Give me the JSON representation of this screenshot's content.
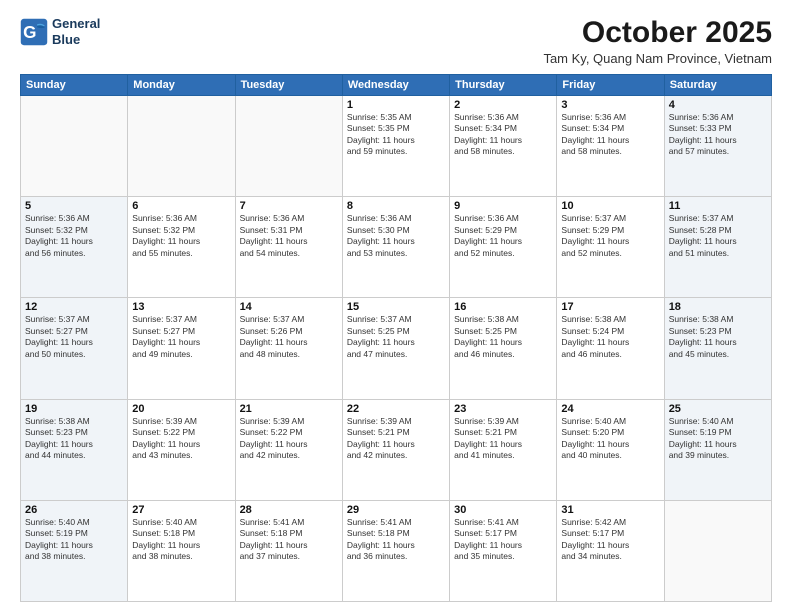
{
  "logo": {
    "line1": "General",
    "line2": "Blue"
  },
  "header": {
    "month": "October 2025",
    "location": "Tam Ky, Quang Nam Province, Vietnam"
  },
  "weekdays": [
    "Sunday",
    "Monday",
    "Tuesday",
    "Wednesday",
    "Thursday",
    "Friday",
    "Saturday"
  ],
  "weeks": [
    [
      {
        "day": "",
        "info": ""
      },
      {
        "day": "",
        "info": ""
      },
      {
        "day": "",
        "info": ""
      },
      {
        "day": "1",
        "info": "Sunrise: 5:35 AM\nSunset: 5:35 PM\nDaylight: 11 hours\nand 59 minutes."
      },
      {
        "day": "2",
        "info": "Sunrise: 5:36 AM\nSunset: 5:34 PM\nDaylight: 11 hours\nand 58 minutes."
      },
      {
        "day": "3",
        "info": "Sunrise: 5:36 AM\nSunset: 5:34 PM\nDaylight: 11 hours\nand 58 minutes."
      },
      {
        "day": "4",
        "info": "Sunrise: 5:36 AM\nSunset: 5:33 PM\nDaylight: 11 hours\nand 57 minutes."
      }
    ],
    [
      {
        "day": "5",
        "info": "Sunrise: 5:36 AM\nSunset: 5:32 PM\nDaylight: 11 hours\nand 56 minutes."
      },
      {
        "day": "6",
        "info": "Sunrise: 5:36 AM\nSunset: 5:32 PM\nDaylight: 11 hours\nand 55 minutes."
      },
      {
        "day": "7",
        "info": "Sunrise: 5:36 AM\nSunset: 5:31 PM\nDaylight: 11 hours\nand 54 minutes."
      },
      {
        "day": "8",
        "info": "Sunrise: 5:36 AM\nSunset: 5:30 PM\nDaylight: 11 hours\nand 53 minutes."
      },
      {
        "day": "9",
        "info": "Sunrise: 5:36 AM\nSunset: 5:29 PM\nDaylight: 11 hours\nand 52 minutes."
      },
      {
        "day": "10",
        "info": "Sunrise: 5:37 AM\nSunset: 5:29 PM\nDaylight: 11 hours\nand 52 minutes."
      },
      {
        "day": "11",
        "info": "Sunrise: 5:37 AM\nSunset: 5:28 PM\nDaylight: 11 hours\nand 51 minutes."
      }
    ],
    [
      {
        "day": "12",
        "info": "Sunrise: 5:37 AM\nSunset: 5:27 PM\nDaylight: 11 hours\nand 50 minutes."
      },
      {
        "day": "13",
        "info": "Sunrise: 5:37 AM\nSunset: 5:27 PM\nDaylight: 11 hours\nand 49 minutes."
      },
      {
        "day": "14",
        "info": "Sunrise: 5:37 AM\nSunset: 5:26 PM\nDaylight: 11 hours\nand 48 minutes."
      },
      {
        "day": "15",
        "info": "Sunrise: 5:37 AM\nSunset: 5:25 PM\nDaylight: 11 hours\nand 47 minutes."
      },
      {
        "day": "16",
        "info": "Sunrise: 5:38 AM\nSunset: 5:25 PM\nDaylight: 11 hours\nand 46 minutes."
      },
      {
        "day": "17",
        "info": "Sunrise: 5:38 AM\nSunset: 5:24 PM\nDaylight: 11 hours\nand 46 minutes."
      },
      {
        "day": "18",
        "info": "Sunrise: 5:38 AM\nSunset: 5:23 PM\nDaylight: 11 hours\nand 45 minutes."
      }
    ],
    [
      {
        "day": "19",
        "info": "Sunrise: 5:38 AM\nSunset: 5:23 PM\nDaylight: 11 hours\nand 44 minutes."
      },
      {
        "day": "20",
        "info": "Sunrise: 5:39 AM\nSunset: 5:22 PM\nDaylight: 11 hours\nand 43 minutes."
      },
      {
        "day": "21",
        "info": "Sunrise: 5:39 AM\nSunset: 5:22 PM\nDaylight: 11 hours\nand 42 minutes."
      },
      {
        "day": "22",
        "info": "Sunrise: 5:39 AM\nSunset: 5:21 PM\nDaylight: 11 hours\nand 42 minutes."
      },
      {
        "day": "23",
        "info": "Sunrise: 5:39 AM\nSunset: 5:21 PM\nDaylight: 11 hours\nand 41 minutes."
      },
      {
        "day": "24",
        "info": "Sunrise: 5:40 AM\nSunset: 5:20 PM\nDaylight: 11 hours\nand 40 minutes."
      },
      {
        "day": "25",
        "info": "Sunrise: 5:40 AM\nSunset: 5:19 PM\nDaylight: 11 hours\nand 39 minutes."
      }
    ],
    [
      {
        "day": "26",
        "info": "Sunrise: 5:40 AM\nSunset: 5:19 PM\nDaylight: 11 hours\nand 38 minutes."
      },
      {
        "day": "27",
        "info": "Sunrise: 5:40 AM\nSunset: 5:18 PM\nDaylight: 11 hours\nand 38 minutes."
      },
      {
        "day": "28",
        "info": "Sunrise: 5:41 AM\nSunset: 5:18 PM\nDaylight: 11 hours\nand 37 minutes."
      },
      {
        "day": "29",
        "info": "Sunrise: 5:41 AM\nSunset: 5:18 PM\nDaylight: 11 hours\nand 36 minutes."
      },
      {
        "day": "30",
        "info": "Sunrise: 5:41 AM\nSunset: 5:17 PM\nDaylight: 11 hours\nand 35 minutes."
      },
      {
        "day": "31",
        "info": "Sunrise: 5:42 AM\nSunset: 5:17 PM\nDaylight: 11 hours\nand 34 minutes."
      },
      {
        "day": "",
        "info": ""
      }
    ]
  ]
}
